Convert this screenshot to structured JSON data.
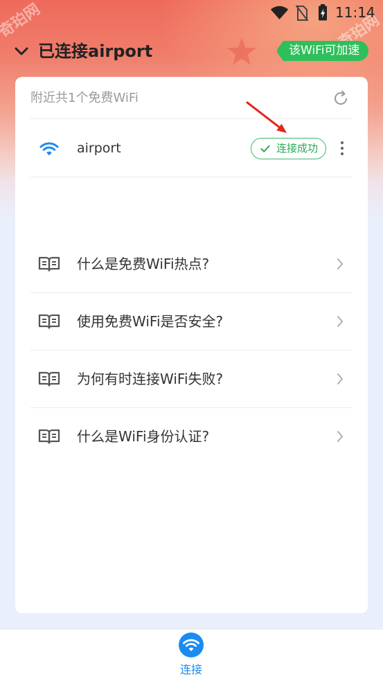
{
  "status_bar": {
    "time": "11:14",
    "icons": [
      "wifi-signal-icon",
      "no-sim-icon",
      "battery-charging-icon"
    ]
  },
  "header": {
    "title": "已连接airport",
    "speedup_badge": "该WiFi可加速",
    "icon": "chevron-down-icon"
  },
  "card": {
    "summary": "附近共1个免费WiFi",
    "refresh_icon": "refresh-icon",
    "networks": [
      {
        "ssid": "airport",
        "status": "连接成功",
        "icon": "wifi-icon"
      }
    ],
    "faq": [
      {
        "label": "什么是免费WiFi热点?",
        "icon": "book-icon"
      },
      {
        "label": "使用免费WiFi是否安全?",
        "icon": "book-icon"
      },
      {
        "label": "为何有时连接WiFi失败?",
        "icon": "book-icon"
      },
      {
        "label": "什么是WiFi身份认证?",
        "icon": "book-icon"
      }
    ]
  },
  "tab_bar": {
    "tabs": [
      {
        "label": "连接",
        "icon": "wifi-icon",
        "active": true
      }
    ]
  },
  "watermark": "奇珀网",
  "colors": {
    "accent_blue": "#1a8cf0",
    "success_green": "#2bb65a",
    "annotation_red": "#e3251c",
    "header_red": "#ee6a5b"
  }
}
